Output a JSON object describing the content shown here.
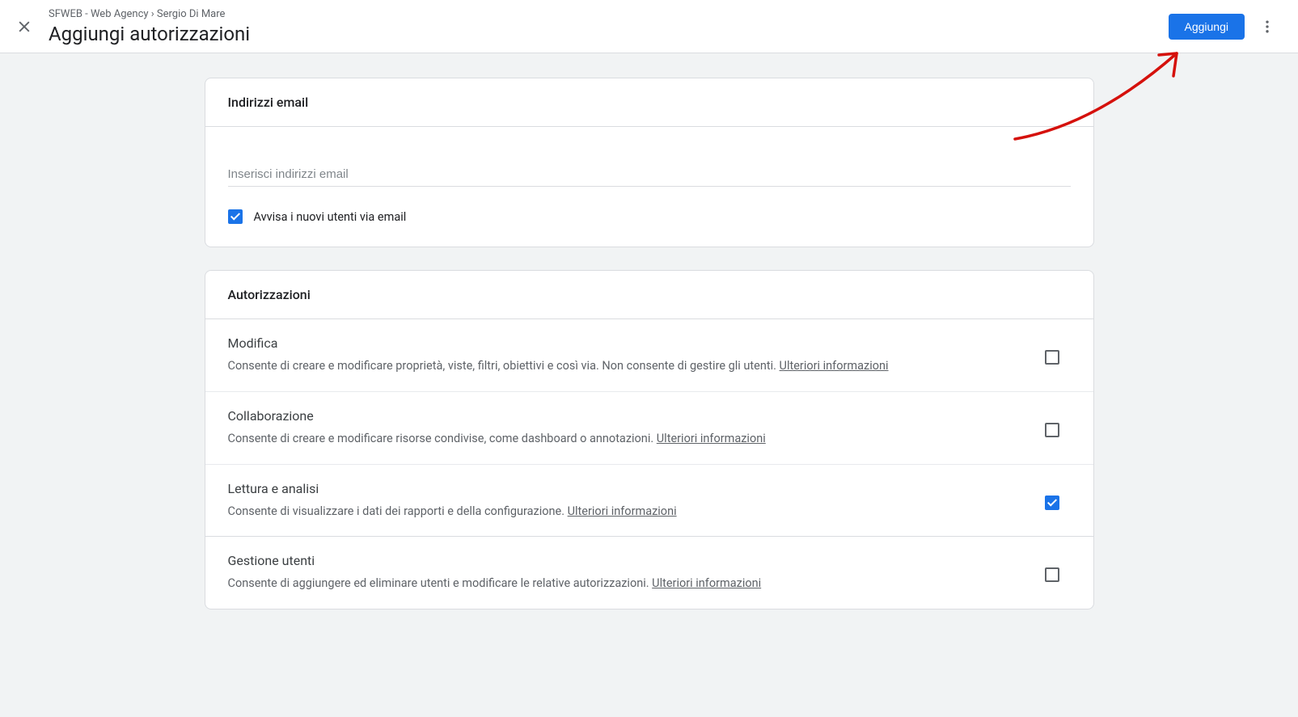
{
  "header": {
    "breadcrumb_account": "SFWEB - Web Agency",
    "breadcrumb_sep": " › ",
    "breadcrumb_user": "Sergio Di Mare",
    "page_title": "Aggiungi autorizzazioni",
    "add_button": "Aggiungi"
  },
  "email_card": {
    "title": "Indirizzi email",
    "placeholder": "Inserisci indirizzi email",
    "notify_label": "Avvisa i nuovi utenti via email",
    "notify_checked": true
  },
  "perm_card": {
    "title": "Autorizzazioni",
    "more_info": "Ulteriori informazioni",
    "items": [
      {
        "title": "Modifica",
        "desc": "Consente di creare e modificare proprietà, viste, filtri, obiettivi e così via. Non consente di gestire gli utenti. ",
        "checked": false
      },
      {
        "title": "Collaborazione",
        "desc": "Consente di creare e modificare risorse condivise, come dashboard o annotazioni. ",
        "checked": false
      },
      {
        "title": "Lettura e analisi",
        "desc": "Consente di visualizzare i dati dei rapporti e della configurazione. ",
        "checked": true
      },
      {
        "title": "Gestione utenti",
        "desc": "Consente di aggiungere ed eliminare utenti e modificare le relative autorizzazioni. ",
        "checked": false
      }
    ]
  }
}
